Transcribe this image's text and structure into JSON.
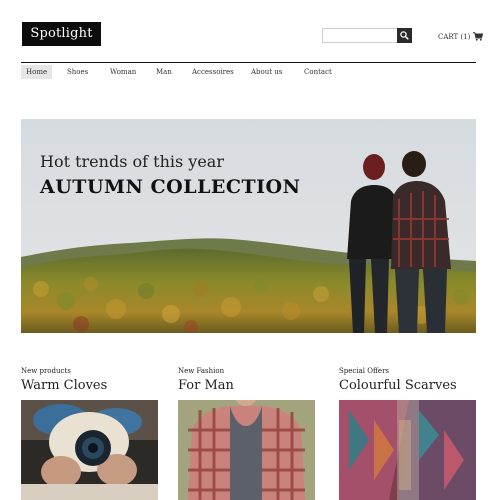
{
  "brand": {
    "name": "Spotlight"
  },
  "search": {
    "placeholder": "",
    "value": "",
    "button_icon": "search-icon"
  },
  "cart": {
    "label": "CART (1)",
    "icon": "shopping-cart-icon"
  },
  "nav": {
    "items": [
      {
        "label": "Home",
        "active": true
      },
      {
        "label": "Shoes"
      },
      {
        "label": "Woman"
      },
      {
        "label": "Man"
      },
      {
        "label": "Accessoires"
      },
      {
        "label": "About us"
      },
      {
        "label": "Contact"
      }
    ]
  },
  "hero": {
    "subtitle": "Hot trends of this year",
    "title": "AUTUMN COLLECTION"
  },
  "products": [
    {
      "eyebrow": "New products",
      "title": "Warm Cloves"
    },
    {
      "eyebrow": "New Fashion",
      "title": "For Man"
    },
    {
      "eyebrow": "Special Offers",
      "title": "Colourful Scarves"
    }
  ],
  "colors": {
    "brand_bg": "#0c0c0c",
    "text": "#222222",
    "nav_active_bg": "#e6e6e6"
  }
}
